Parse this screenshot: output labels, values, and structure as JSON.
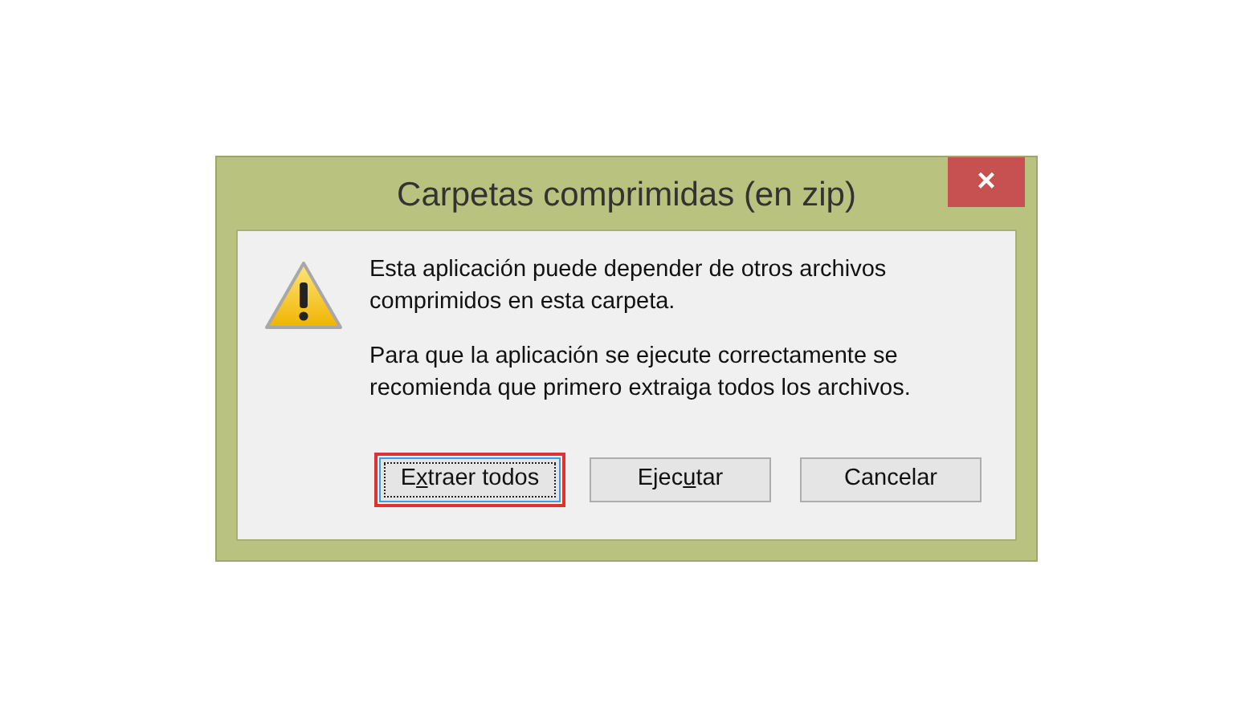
{
  "window": {
    "title": "Carpetas comprimidas (en zip)",
    "close": "×"
  },
  "message": {
    "paragraphs": [
      "Esta aplicación puede depender de otros archivos comprimidos en esta carpeta.",
      "Para que la aplicación se ejecute correctamente se recomienda que primero extraiga todos los archivos."
    ]
  },
  "buttons": [
    {
      "pre": "E",
      "key": "x",
      "post": "traer todos",
      "focused": true,
      "highlighted": true
    },
    {
      "pre": "Ejec",
      "key": "u",
      "post": "tar",
      "focused": false,
      "highlighted": false
    },
    {
      "pre": "Cancelar",
      "focused": false,
      "highlighted": false
    }
  ]
}
